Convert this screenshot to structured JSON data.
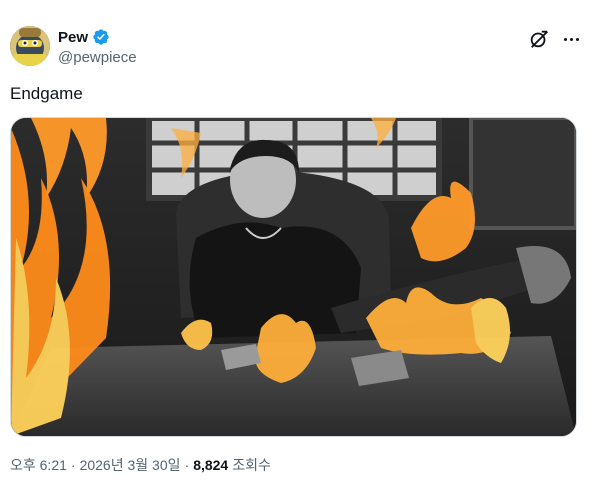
{
  "tweet": {
    "author": {
      "display_name": "Pew",
      "handle": "@pewpiece",
      "verified": true,
      "avatar_icon": "avatar-illustration"
    },
    "text": "Endgame",
    "media": {
      "type": "image",
      "description_icon": "photo"
    },
    "meta": {
      "time": "오후 6:21",
      "separator": "·",
      "date": "2026년 3월 30일",
      "views_count": "8,824",
      "views_label": "조회수"
    },
    "actions": {
      "grok_icon": "grok-icon",
      "more_icon": "more-icon"
    }
  },
  "colors": {
    "verified": "#1d9bf0",
    "text_primary": "#0f1419",
    "text_secondary": "#536471",
    "border": "#cfd9de"
  }
}
